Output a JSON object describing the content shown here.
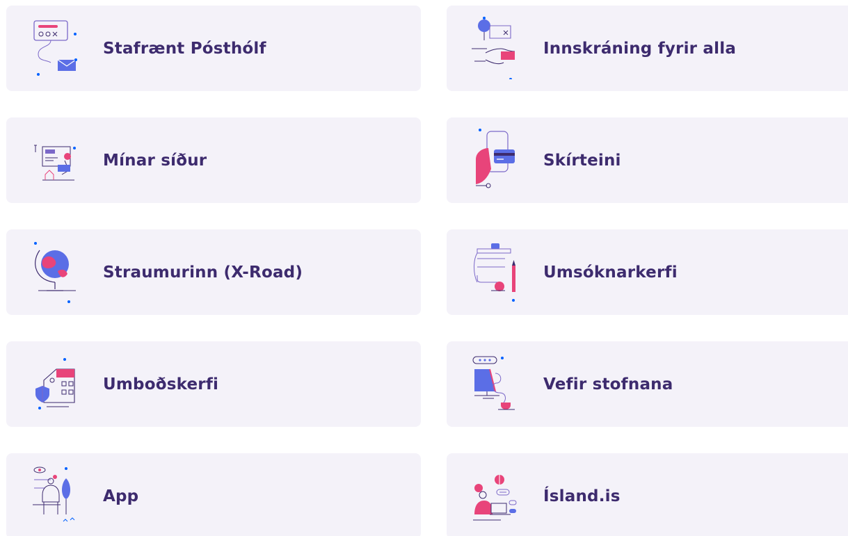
{
  "colors": {
    "card_bg": "#f4f2f9",
    "label": "#3d2b6e",
    "accent_blue": "#0061ff",
    "accent_pink": "#e8447a",
    "accent_purple": "#7b68c8"
  },
  "cards": [
    {
      "label": "Stafrænt Pósthólf",
      "icon": "digital-mailbox-icon"
    },
    {
      "label": "Innskráning fyrir alla",
      "icon": "handshake-login-icon"
    },
    {
      "label": "Mínar síður",
      "icon": "person-at-desk-icon"
    },
    {
      "label": "Skírteini",
      "icon": "phone-card-icon"
    },
    {
      "label": "Straumurinn (X-Road)",
      "icon": "globe-icon"
    },
    {
      "label": "Umsóknarkerfi",
      "icon": "clipboard-form-icon"
    },
    {
      "label": "Umboðskerfi",
      "icon": "building-shield-icon"
    },
    {
      "label": "Vefir stofnana",
      "icon": "monitor-web-icon"
    },
    {
      "label": "App",
      "icon": "person-with-phone-icon"
    },
    {
      "label": "Ísland.is",
      "icon": "person-with-laptop-icon"
    }
  ]
}
